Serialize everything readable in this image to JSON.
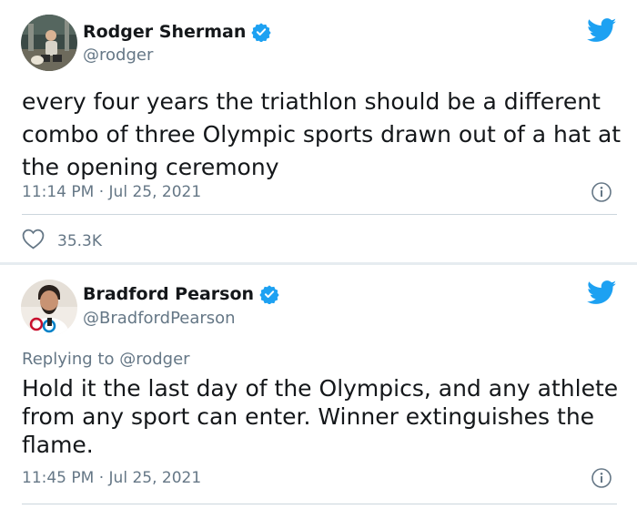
{
  "tweets": [
    {
      "author": {
        "display_name": "Rodger Sherman",
        "handle": "@rodger",
        "verified": true
      },
      "text": "every four years the triathlon should be a different combo of three Olympic sports drawn out of a hat at the opening ceremony",
      "time": "11:14 PM",
      "dot": "·",
      "date": "Jul 25, 2021",
      "likes": "35.3K"
    },
    {
      "author": {
        "display_name": "Bradford Pearson",
        "handle": "@BradfordPearson",
        "verified": true
      },
      "reply_prefix": "Replying to",
      "reply_to": "@rodger",
      "text": "Hold it the last day of the Olympics, and any athlete from any sport can enter. Winner extinguishes the flame.",
      "time": "11:45 PM",
      "dot": "·",
      "date": "Jul 25, 2021"
    }
  ],
  "icons": {
    "brand": "twitter-bird-icon",
    "verified": "verified-badge-icon",
    "info": "info-icon",
    "like": "heart-icon"
  },
  "colors": {
    "twitter_blue": "#1da1f2",
    "text_primary": "#14171a",
    "text_secondary": "#657786",
    "divider": "#ccd6dd",
    "background": "#e6ecf0"
  }
}
